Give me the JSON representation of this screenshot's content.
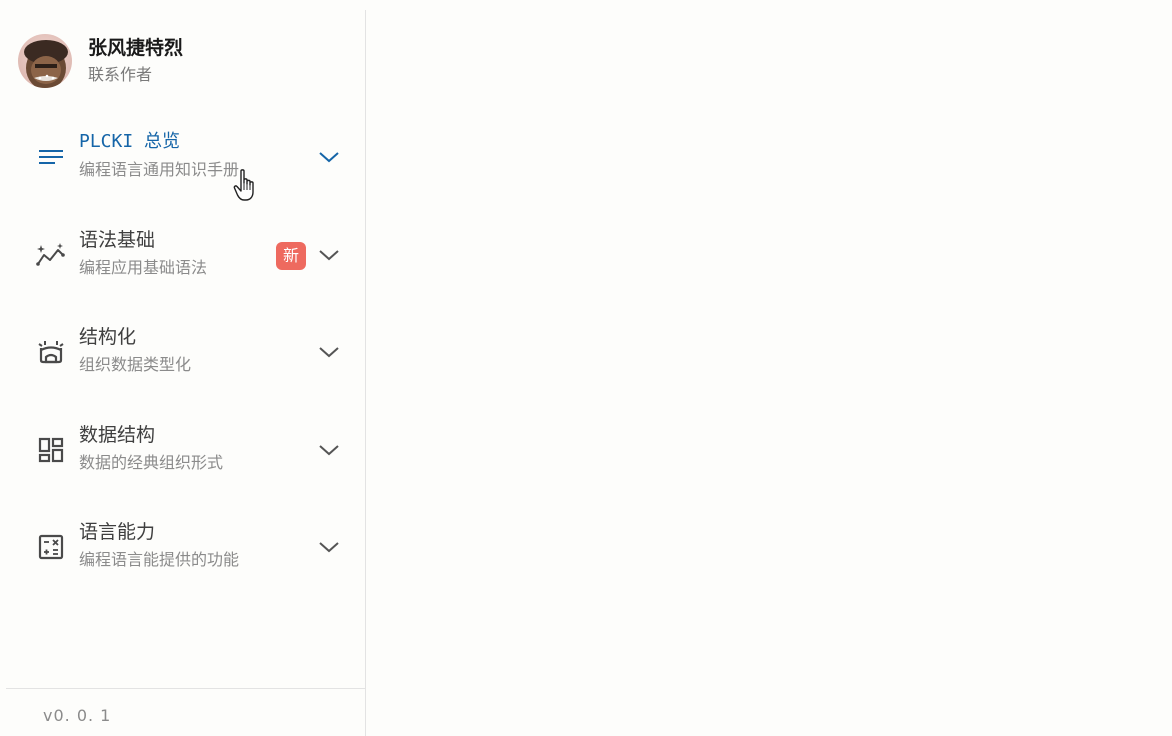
{
  "profile": {
    "name": "张风捷特烈",
    "contact_label": "联系作者",
    "avatar_icon": "author-avatar"
  },
  "nav": {
    "items": [
      {
        "title": "PLCKI 总览",
        "subtitle": "编程语言通用知识手册",
        "icon": "list-lines-icon",
        "active": true
      },
      {
        "title": "语法基础",
        "subtitle": "编程应用基础语法",
        "icon": "sparkle-chart-icon",
        "badge": "新"
      },
      {
        "title": "结构化",
        "subtitle": "组织数据类型化",
        "icon": "structure-icon"
      },
      {
        "title": "数据结构",
        "subtitle": "数据的经典组织形式",
        "icon": "dashboard-grid-icon"
      },
      {
        "title": "语言能力",
        "subtitle": "编程语言能提供的功能",
        "icon": "calculator-icon"
      }
    ]
  },
  "footer": {
    "version": "v0. 0. 1"
  },
  "colors": {
    "accent": "#1565a8",
    "badge": "#ee6a5f",
    "text_primary": "#3f3f3f",
    "text_secondary": "#8b8b8b",
    "divider": "#e3e3e3",
    "background": "#fdfdfb"
  }
}
